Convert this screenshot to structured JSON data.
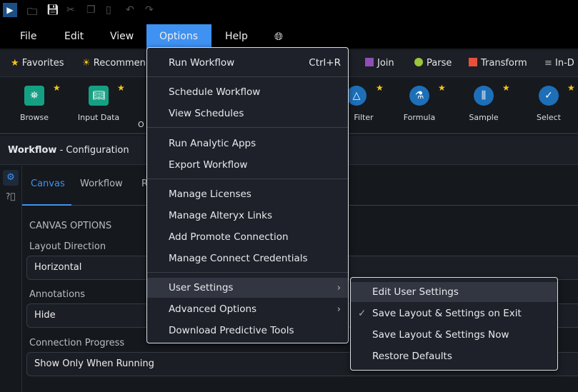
{
  "quick_access": {
    "icons": [
      "app-logo-icon",
      "open-folder-icon",
      "save-icon",
      "cut-icon",
      "copy-icon",
      "paste-icon",
      "undo-icon",
      "redo-icon"
    ]
  },
  "menubar": {
    "items": [
      "File",
      "Edit",
      "View",
      "Options",
      "Help"
    ],
    "active": "Options",
    "globe_icon": "globe-icon"
  },
  "categories": [
    {
      "label": "Favorites",
      "icon": "star-icon"
    },
    {
      "label": "Recommen",
      "icon": "sun-icon"
    },
    {
      "label": "Join",
      "color": "#8e4fb5"
    },
    {
      "label": "Parse",
      "color": "#9bc53d"
    },
    {
      "label": "Transform",
      "color": "#e8503a"
    },
    {
      "label": "In-D",
      "icon": "database-icon"
    }
  ],
  "tools": [
    {
      "label": "Browse"
    },
    {
      "label": "Input Data"
    },
    {
      "label": "O"
    },
    {
      "label": "Filter"
    },
    {
      "label": "Formula"
    },
    {
      "label": "Sample"
    },
    {
      "label": "Select"
    }
  ],
  "config": {
    "title": "Workflow",
    "subtitle": "- Configuration",
    "tabs": [
      "Canvas",
      "Workflow",
      "R"
    ],
    "section": "CANVAS OPTIONS",
    "fields": [
      {
        "label": "Layout Direction",
        "value": "Horizontal"
      },
      {
        "label": "Annotations",
        "value": "Hide"
      },
      {
        "label": "Connection Progress",
        "value": "Show Only When Running"
      }
    ]
  },
  "options_menu": {
    "items": [
      {
        "label": "Run Workflow",
        "shortcut": "Ctrl+R"
      },
      {
        "label": "Schedule Workflow"
      },
      {
        "label": "View Schedules"
      },
      {
        "label": "Run Analytic Apps"
      },
      {
        "label": "Export Workflow"
      },
      {
        "label": "Manage Licenses"
      },
      {
        "label": "Manage Alteryx Links"
      },
      {
        "label": "Add Promote Connection"
      },
      {
        "label": "Manage Connect Credentials"
      },
      {
        "label": "User Settings"
      },
      {
        "label": "Advanced Options"
      },
      {
        "label": "Download Predictive Tools"
      }
    ]
  },
  "user_settings_menu": {
    "items": [
      {
        "label": "Edit User Settings"
      },
      {
        "label": "Save Layout & Settings on Exit",
        "checked": true
      },
      {
        "label": "Save Layout & Settings Now"
      },
      {
        "label": "Restore Defaults"
      }
    ]
  },
  "colors": {
    "accent": "#3f91f2"
  }
}
